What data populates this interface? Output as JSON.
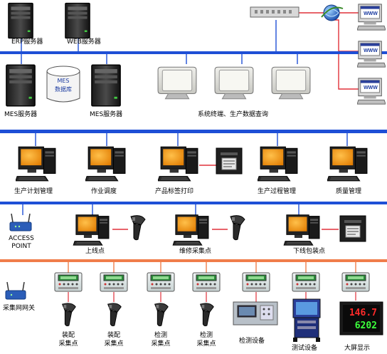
{
  "diagram": {
    "top_servers": {
      "erp_label": "ERP服务器",
      "web_label": "WEB服务器"
    },
    "mes_tier": {
      "mes_server_left_label": "MES服务器",
      "mes_server_right_label": "MES服务器",
      "database_line1": "MES",
      "database_line2": "数据库",
      "terminals_label": "系统终端、生产数据查询"
    },
    "www_label": "WWW",
    "management_tier": [
      {
        "label": "生产计划管理"
      },
      {
        "label": "作业调度"
      },
      {
        "label": "产品标签打印"
      },
      {
        "label": "生产过程管理"
      },
      {
        "label": "质量管理"
      }
    ],
    "station_tier": {
      "access_point_line1": "ACCESS",
      "access_point_line2": "POINT",
      "online_label": "上线点",
      "repair_label": "维修采集点",
      "offline_label": "下线包装点"
    },
    "collection_tier": {
      "gateway_label": "采集网网关",
      "assembly_1_line1": "装配",
      "assembly_1_line2": "采集点",
      "assembly_2_line1": "装配",
      "assembly_2_line2": "采集点",
      "inspect_1_line1": "检测",
      "inspect_1_line2": "采集点",
      "inspect_2_line1": "检测",
      "inspect_2_line2": "采集点",
      "inspect_device_label": "检测设备",
      "test_device_label": "测试设备",
      "big_screen_label": "大屏显示",
      "display_line1": "146.7",
      "display_line2": "6202"
    },
    "colors": {
      "bus_blue": "#1e4fd6",
      "bus_orange": "#f07d4a",
      "link_red": "#e0303a",
      "screen_orange": "#f09a10"
    }
  }
}
